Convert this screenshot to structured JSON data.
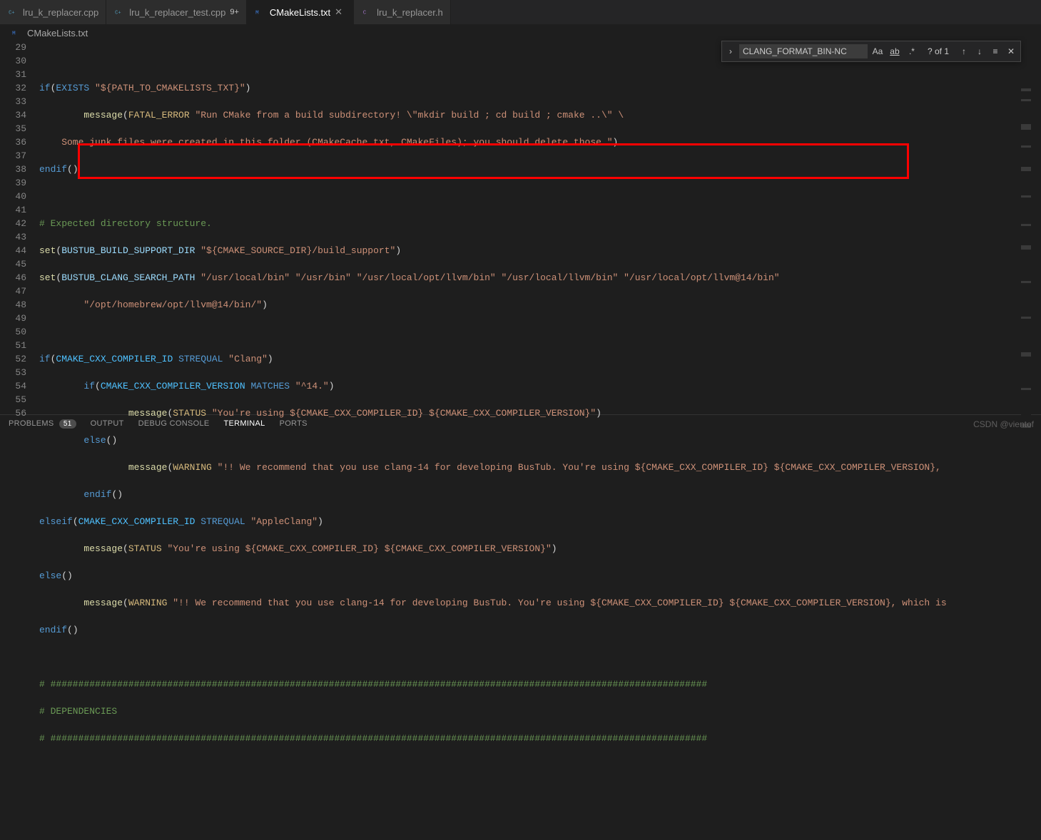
{
  "tabs": [
    {
      "icon": "cpp",
      "label": "lru_k_replacer.cpp",
      "mod": ""
    },
    {
      "icon": "cpp",
      "label": "lru_k_replacer_test.cpp",
      "mod": "9+"
    },
    {
      "icon": "cmake",
      "label": "CMakeLists.txt",
      "mod": "",
      "active": true,
      "close": true
    },
    {
      "icon": "c",
      "label": "lru_k_replacer.h",
      "mod": ""
    }
  ],
  "breadcrumb": {
    "icon": "cmake",
    "label": "CMakeLists.txt"
  },
  "find": {
    "value": "CLANG_FORMAT_BIN-NC",
    "results": "? of 1",
    "opts": {
      "case": "Aa",
      "word": "ab",
      "regex": ".*"
    }
  },
  "lines": {
    "start": 29,
    "end": 56
  },
  "code": {
    "l30_if": "if",
    "l30_exists": "EXISTS",
    "l30_str": " \"${PATH_TO_CMAKELISTS_TXT}\"",
    "l31_msg": "message",
    "l31_fatal": "FATAL_ERROR",
    "l31_str": " \"Run CMake from a build subdirectory! \\\"mkdir build ; cd build ; cmake ..\\\" \\",
    "l32_str": "    Some junk files were created in this folder (CMakeCache.txt, CMakeFiles); you should delete those.\"",
    "l33_endif": "endif",
    "l35_cmt": "# Expected directory structure.",
    "l36_set": "set",
    "l36_var": "BUSTUB_BUILD_SUPPORT_DIR",
    "l36_str": " \"${CMAKE_SOURCE_DIR}/build_support\"",
    "l37_set": "set",
    "l37_var": "BUSTUB_CLANG_SEARCH_PATH",
    "l37_str": " \"/usr/local/bin\" \"/usr/bin\" \"/usr/local/opt/llvm/bin\" \"/usr/local/llvm/bin\" \"/usr/local/opt/llvm@14/bin\"",
    "l38_str": "        \"/opt/homebrew/opt/llvm@14/bin/\"",
    "l40_if": "if",
    "l40_var": "CMAKE_CXX_COMPILER_ID",
    "l40_streq": "STREQUAL",
    "l40_str": " \"Clang\"",
    "l41_if": "if",
    "l41_var": "CMAKE_CXX_COMPILER_VERSION",
    "l41_matches": "MATCHES",
    "l41_str": " \"^14.\"",
    "l42_msg": "message",
    "l42_status": "STATUS",
    "l42_str": " \"You're using ${CMAKE_CXX_COMPILER_ID} ${CMAKE_CXX_COMPILER_VERSION}\"",
    "l43_else": "else",
    "l44_msg": "message",
    "l44_warn": "WARNING",
    "l44_str": " \"!! We recommend that you use clang-14 for developing BusTub. You're using ${CMAKE_CXX_COMPILER_ID} ${CMAKE_CXX_COMPILER_VERSION},",
    "l45_endif": "endif",
    "l46_elseif": "elseif",
    "l46_var": "CMAKE_CXX_COMPILER_ID",
    "l46_streq": "STREQUAL",
    "l46_str": " \"AppleClang\"",
    "l47_msg": "message",
    "l47_status": "STATUS",
    "l47_str": " \"You're using ${CMAKE_CXX_COMPILER_ID} ${CMAKE_CXX_COMPILER_VERSION}\"",
    "l48_else": "else",
    "l49_msg": "message",
    "l49_warn": "WARNING",
    "l49_str": " \"!! We recommend that you use clang-14 for developing BusTub. You're using ${CMAKE_CXX_COMPILER_ID} ${CMAKE_CXX_COMPILER_VERSION}, which is",
    "l50_endif": "endif",
    "l52_hr": "# ######################################################################################################################",
    "l53_dep": "# DEPENDENCIES",
    "l54_hr": "# ######################################################################################################################"
  },
  "panel": {
    "problems": "PROBLEMS",
    "problems_badge": "51",
    "output": "OUTPUT",
    "debug": "DEBUG CONSOLE",
    "terminal": "TERMINAL",
    "ports": "PORTS"
  },
  "watermark": "CSDN @vientof"
}
